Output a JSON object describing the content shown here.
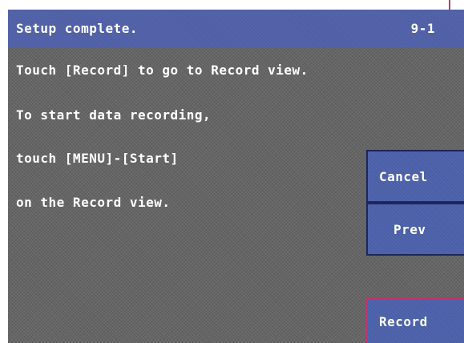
{
  "title_bar": {
    "title": "Setup complete.",
    "page_number": "9-1"
  },
  "message_lines": [
    "Touch [Record] to go to Record view.",
    "To start data recording,",
    "touch [MENU]-[Start]",
    "on the Record view."
  ],
  "buttons": {
    "cancel": "Cancel",
    "prev": "Prev",
    "record": "Record"
  },
  "colors": {
    "title_bar": "#4f5fa6",
    "background": "#656565",
    "button": "#4a5fa8",
    "record_border": "#c8306e"
  }
}
